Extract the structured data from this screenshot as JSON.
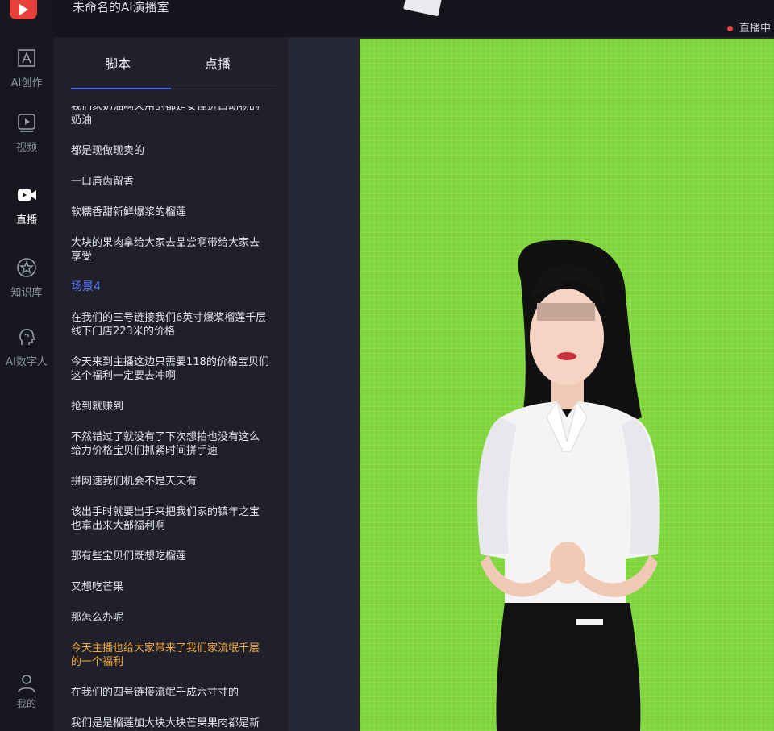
{
  "app": {
    "title": "未命名的AI演播室",
    "live_status": "直播中"
  },
  "nav": {
    "items": [
      {
        "label": "AI创作",
        "icon": "ai-create-icon"
      },
      {
        "label": "视频",
        "icon": "video-icon"
      },
      {
        "label": "直播",
        "icon": "live-camera-icon",
        "active": true
      },
      {
        "label": "知识库",
        "icon": "star-badge-icon"
      },
      {
        "label": "AI数字人",
        "icon": "digital-human-icon"
      }
    ],
    "profile_label": "我的"
  },
  "script_panel": {
    "tabs": [
      {
        "label": "脚本",
        "active": true
      },
      {
        "label": "点播",
        "active": false
      }
    ],
    "lines": [
      {
        "text": "我们家奶油啊采用的都是安佳进口动物的奶油",
        "kind": "partial"
      },
      {
        "text": "都是现做现卖的",
        "kind": "normal"
      },
      {
        "text": "一口唇齿留香",
        "kind": "normal"
      },
      {
        "text": "软糯香甜新鲜爆浆的榴莲",
        "kind": "normal"
      },
      {
        "text": "大块的果肉拿给大家去品尝啊带给大家去享受",
        "kind": "normal"
      },
      {
        "text": "场景4",
        "kind": "scene"
      },
      {
        "text": "在我们的三号链接我们6英寸爆浆榴莲千层线下门店223米的价格",
        "kind": "normal"
      },
      {
        "text": "今天来到主播这边只需要118的价格宝贝们这个福利一定要去冲啊",
        "kind": "normal"
      },
      {
        "text": "抢到就赚到",
        "kind": "normal"
      },
      {
        "text": "不然错过了就没有了下次想拍也没有这么给力价格宝贝们抓紧时间拼手速",
        "kind": "normal"
      },
      {
        "text": "拼网速我们机会不是天天有",
        "kind": "normal"
      },
      {
        "text": "该出手时就要出手来把我们家的镇年之宝也拿出来大部福利啊",
        "kind": "normal"
      },
      {
        "text": "那有些宝贝们既想吃榴莲",
        "kind": "normal"
      },
      {
        "text": "又想吃芒果",
        "kind": "normal"
      },
      {
        "text": "那怎么办呢",
        "kind": "normal"
      },
      {
        "text": "今天主播也给大家带来了我们家流氓千层的一个福利",
        "kind": "current"
      },
      {
        "text": "在我们的四号链接流氓千成六寸寸的",
        "kind": "normal"
      },
      {
        "text": "我们是是榴莲加大块大块芒果果肉都是新鲜现做的一个榴芒千层",
        "kind": "normal"
      }
    ]
  },
  "preview": {
    "background_color": "#7ed63a"
  }
}
